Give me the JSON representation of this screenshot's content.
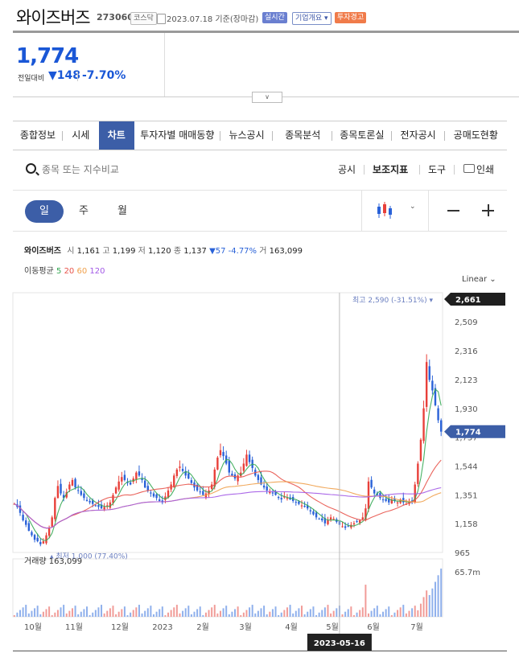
{
  "header": {
    "name": "와이즈버즈",
    "code": "273060",
    "market": "코스닥",
    "date_label": "2023.07.18 기준(장마감)",
    "realtime_badge": "실시간",
    "company_badge": "기업개요 ▾",
    "warning_badge": "투자경고"
  },
  "quote": {
    "price": "1,774",
    "change_label": "전일대비",
    "change_amount": "148",
    "change_pct": "-7.70%"
  },
  "tabs": [
    "종합정보",
    "시세",
    "차트",
    "투자자별 매매동향",
    "뉴스공시",
    "종목분석",
    "종목토론실",
    "전자공시",
    "공매도현황"
  ],
  "active_tab": 2,
  "toolbar": {
    "search_placeholder": "종목 또는 지수비교",
    "disclosure": "공시",
    "indicator": "보조지표",
    "tool": "도구",
    "print": "인쇄"
  },
  "periods": [
    "일",
    "주",
    "월"
  ],
  "active_period": 0,
  "ohlc": {
    "name": "와이즈버즈",
    "open_label": "시",
    "open": "1,161",
    "high_label": "고",
    "high": "1,199",
    "low_label": "저",
    "low": "1,120",
    "close_label": "종",
    "close": "1,137",
    "change": "57 -4.77%",
    "volume_label": "거",
    "volume": "163,099"
  },
  "moving_average": {
    "label": "이동평균",
    "periods": [
      "5",
      "20",
      "60",
      "120"
    ],
    "colors": [
      "#34a853",
      "#e8534a",
      "#f0a04b",
      "#a259e6"
    ]
  },
  "scale_mode": "Linear",
  "chart_data": {
    "type": "candlestick",
    "y_ticks": [
      2509,
      2316,
      2123,
      1930,
      1737,
      1544,
      1351,
      1158,
      965
    ],
    "y_tick_labels": [
      "2,509",
      "2,316",
      "2,123",
      "1,930",
      "1,737",
      "1,544",
      "1,351",
      "1,158",
      "965"
    ],
    "ylim": [
      965,
      2661
    ],
    "x_ticks": [
      "10월",
      "11월",
      "12월",
      "2023",
      "2월",
      "3월",
      "4월",
      "5월",
      "6월",
      "7월"
    ],
    "max_marker": {
      "value": 2661,
      "label": "2,661"
    },
    "high_annotation": "최고 2,590 (-31.51%)",
    "low_annotation": "최저 1,000 (77.40%)",
    "last_price": {
      "value": 1774,
      "label": "1,774"
    },
    "crosshair_date": "2023-05-16",
    "volume_label": "거래량",
    "volume_value": "163,099",
    "volume_max_label": "65.7m",
    "up_color": "#e8403a",
    "down_color": "#2a62d8",
    "close_series": [
      1290,
      1270,
      1230,
      1180,
      1150,
      1110,
      1080,
      1050,
      1040,
      1020,
      1040,
      1080,
      1130,
      1200,
      1330,
      1410,
      1360,
      1330,
      1370,
      1420,
      1450,
      1400,
      1380,
      1350,
      1330,
      1310,
      1300,
      1290,
      1280,
      1270,
      1260,
      1270,
      1280,
      1300,
      1350,
      1400,
      1440,
      1470,
      1450,
      1430,
      1420,
      1460,
      1500,
      1480,
      1450,
      1400,
      1380,
      1360,
      1340,
      1330,
      1310,
      1300,
      1340,
      1380,
      1420,
      1480,
      1520,
      1540,
      1510,
      1480,
      1460,
      1430,
      1400,
      1380,
      1370,
      1350,
      1360,
      1380,
      1420,
      1520,
      1600,
      1650,
      1610,
      1560,
      1500,
      1480,
      1460,
      1480,
      1500,
      1560,
      1620,
      1570,
      1530,
      1480,
      1450,
      1420,
      1400,
      1380,
      1370,
      1360,
      1350,
      1330,
      1320,
      1340,
      1330,
      1320,
      1310,
      1300,
      1290,
      1280,
      1270,
      1260,
      1240,
      1220,
      1200,
      1190,
      1180,
      1160,
      1180,
      1200,
      1190,
      1170,
      1150,
      1140,
      1130,
      1140,
      1150,
      1160,
      1170,
      1180,
      1200,
      1260,
      1440,
      1400,
      1360,
      1350,
      1330,
      1320,
      1310,
      1300,
      1320,
      1310,
      1300,
      1320,
      1300,
      1290,
      1300,
      1310,
      1420,
      1560,
      1720,
      1930,
      2240,
      2120,
      2050,
      1950,
      1850,
      1774
    ]
  }
}
